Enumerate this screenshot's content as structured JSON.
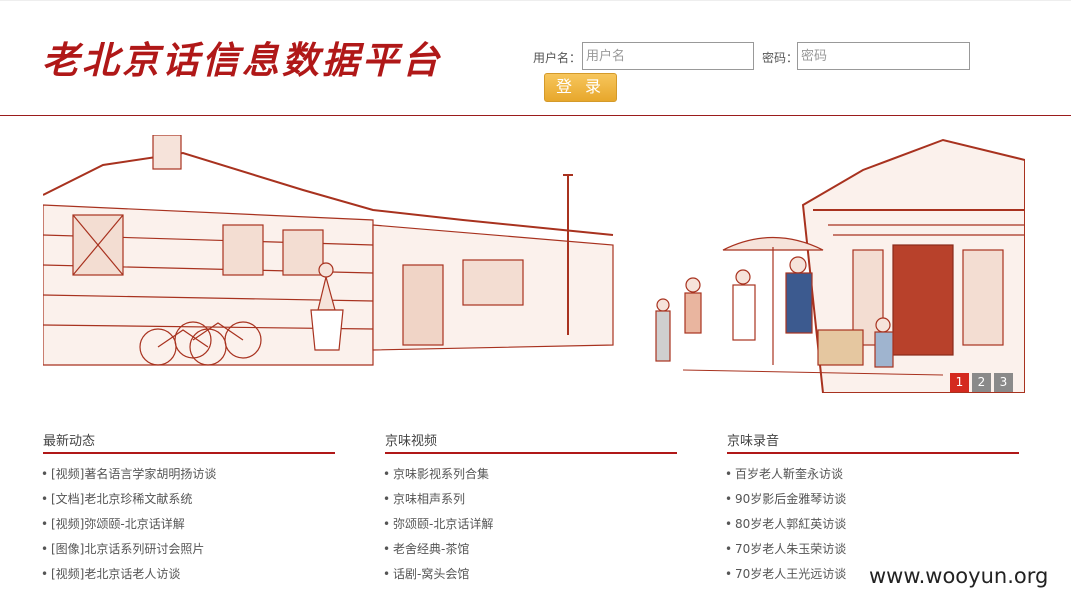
{
  "header": {
    "logo_text": "老北京话信息数据平台",
    "username_label": "用户名：",
    "username_placeholder": "用户名",
    "password_label": "密码：",
    "password_placeholder": "密码",
    "login_label": "登 录"
  },
  "carousel": {
    "indicators": [
      "1",
      "2",
      "3"
    ],
    "active_index": 0
  },
  "columns": [
    {
      "title": "最新动态",
      "items": [
        "[视频]著名语言学家胡明扬访谈",
        "[文档]老北京珍稀文献系统",
        "[视频]弥颂颐-北京话详解",
        "[图像]北京话系列研讨会照片",
        "[视频]老北京话老人访谈"
      ]
    },
    {
      "title": "京味视频",
      "items": [
        "京味影视系列合集",
        "京味相声系列",
        "弥颂颐-北京话详解",
        "老舍经典-茶馆",
        "话剧-窝头会馆"
      ]
    },
    {
      "title": "京味录音",
      "items": [
        "百岁老人靳奎永访谈",
        "90岁影后金雅琴访谈",
        "80岁老人郭紅英访谈",
        "70岁老人朱玉荣访谈",
        "70岁老人王光远访谈"
      ]
    }
  ],
  "watermark": "www.wooyun.org",
  "colors": {
    "brand_red": "#b01818",
    "banner_ink": "#a8321f",
    "login_gold": "#e8a82e"
  }
}
